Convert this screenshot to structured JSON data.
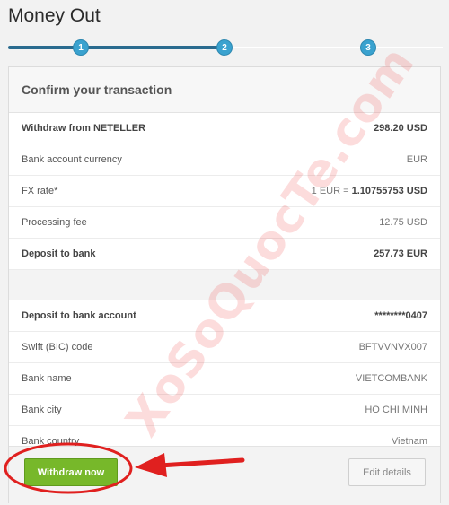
{
  "page": {
    "title": "Money Out"
  },
  "stepper": {
    "steps": [
      "1",
      "2",
      "3"
    ],
    "current": 2
  },
  "card": {
    "title": "Confirm your transaction",
    "summary": [
      {
        "label": "Withdraw from NETELLER",
        "value": "298.20 USD",
        "bold": true
      },
      {
        "label": "Bank account currency",
        "value": "EUR"
      },
      {
        "label": "FX rate*",
        "value_prefix": "1 EUR = ",
        "value": "1.10755753 USD"
      },
      {
        "label": "Processing fee",
        "value": "12.75 USD"
      },
      {
        "label": "Deposit to bank",
        "value": "257.73 EUR",
        "bold": true
      }
    ],
    "bank": [
      {
        "label": "Deposit to bank account",
        "value": "********0407",
        "bold": true
      },
      {
        "label": "Swift (BIC) code",
        "value": "BFTVVNVX007"
      },
      {
        "label": "Bank name",
        "value": "VIETCOMBANK"
      },
      {
        "label": "Bank city",
        "value": "HO CHI MINH"
      },
      {
        "label": "Bank country",
        "value": "Vietnam"
      }
    ]
  },
  "actions": {
    "withdraw_label": "Withdraw now",
    "edit_label": "Edit details"
  },
  "watermark": "XoSoQuocTe.com",
  "colors": {
    "primary_button": "#77b82a",
    "stepper": "#3aa2cf",
    "annotation": "#e0201f"
  }
}
